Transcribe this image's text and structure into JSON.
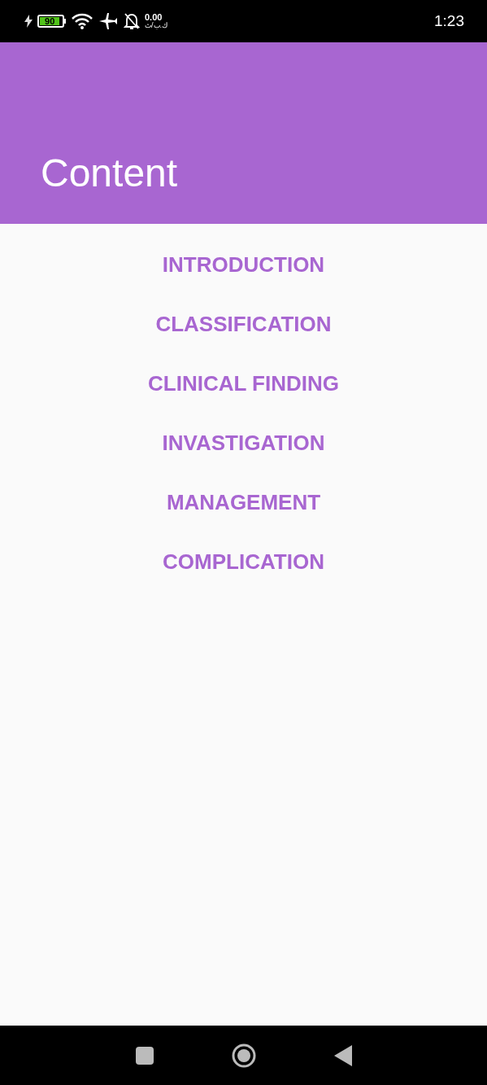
{
  "status_bar": {
    "battery": "90",
    "net_speed": "0.00",
    "net_unit": "ك.ب/ث",
    "time": "1:23"
  },
  "app_bar": {
    "title": "Content"
  },
  "items": [
    "INTRODUCTION",
    "CLASSIFICATION",
    "CLINICAL FINDING",
    "INVASTIGATION",
    "MANAGEMENT",
    "COMPLICATION"
  ]
}
